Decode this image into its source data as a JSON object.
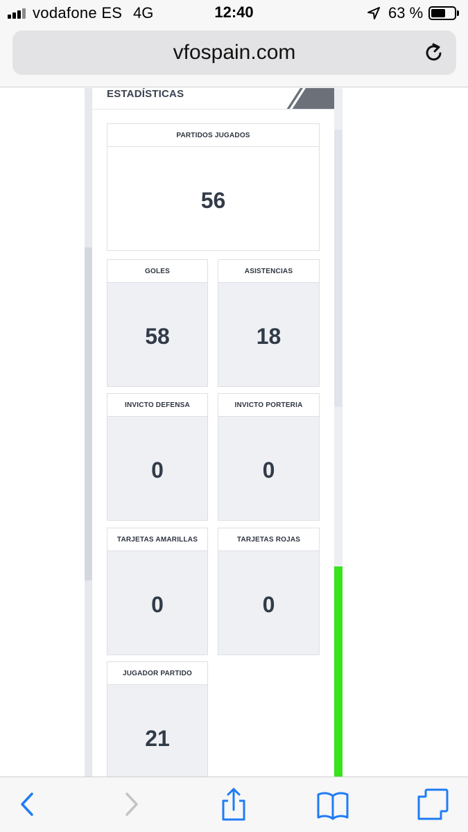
{
  "status_bar": {
    "carrier": "vodafone ES",
    "network": "4G",
    "time": "12:40",
    "battery_percent_label": "63 %",
    "battery_level": 0.63,
    "signal_bars": 4
  },
  "browser": {
    "url": "vfospain.com"
  },
  "section": {
    "title": "ESTADÍSTICAS"
  },
  "stats": {
    "partidos_jugados": {
      "label": "PARTIDOS JUGADOS",
      "value": "56"
    },
    "goles": {
      "label": "GOLES",
      "value": "58"
    },
    "asistencias": {
      "label": "ASISTENCIAS",
      "value": "18"
    },
    "invicto_defensa": {
      "label": "INVICTO DEFENSA",
      "value": "0"
    },
    "invicto_porteria": {
      "label": "INVICTO PORTERIA",
      "value": "0"
    },
    "tarjetas_amarillas": {
      "label": "TARJETAS AMARILLAS",
      "value": "0"
    },
    "tarjetas_rojas": {
      "label": "TARJETAS ROJAS",
      "value": "0"
    },
    "jugador_partido": {
      "label": "JUGADOR PARTIDO",
      "value": "21"
    }
  },
  "colors": {
    "accent_green": "#38e21c",
    "ios_blue": "#1f7cf5",
    "value_text": "#323b48"
  },
  "icons": {
    "back": "chevron-left-icon",
    "forward": "chevron-right-icon",
    "share": "share-icon",
    "bookmarks": "book-icon",
    "tabs": "tabs-icon",
    "reload": "reload-icon",
    "location": "location-arrow-icon"
  }
}
